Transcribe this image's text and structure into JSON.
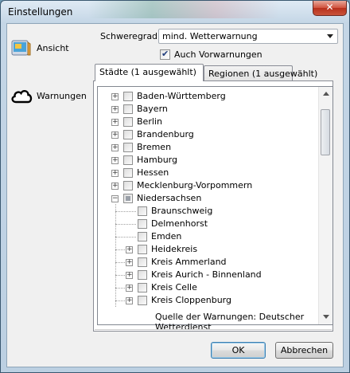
{
  "window": {
    "title": "Einstellungen",
    "close_glyph": "✕"
  },
  "sidebar": {
    "items": [
      {
        "label": "Ansicht",
        "icon": "display-icon"
      },
      {
        "label": "Warnungen",
        "icon": "cloud-icon"
      }
    ]
  },
  "settings": {
    "severity_label": "Schweregrad:",
    "severity_value": "mind. Wetterwarnung",
    "prewarnings_label": "Auch Vorwarnungen",
    "prewarnings_checked": true
  },
  "tabs": [
    {
      "label": "Städte (1 ausgewählt)",
      "active": true
    },
    {
      "label": "Regionen (1 ausgewählt)",
      "active": false
    }
  ],
  "tree": [
    {
      "label": "Baden-Württemberg",
      "level": 0,
      "expander": "+",
      "state": "unchecked"
    },
    {
      "label": "Bayern",
      "level": 0,
      "expander": "+",
      "state": "unchecked"
    },
    {
      "label": "Berlin",
      "level": 0,
      "expander": "+",
      "state": "unchecked"
    },
    {
      "label": "Brandenburg",
      "level": 0,
      "expander": "+",
      "state": "unchecked"
    },
    {
      "label": "Bremen",
      "level": 0,
      "expander": "+",
      "state": "unchecked"
    },
    {
      "label": "Hamburg",
      "level": 0,
      "expander": "+",
      "state": "unchecked"
    },
    {
      "label": "Hessen",
      "level": 0,
      "expander": "+",
      "state": "unchecked"
    },
    {
      "label": "Mecklenburg-Vorpommern",
      "level": 0,
      "expander": "+",
      "state": "unchecked"
    },
    {
      "label": "Niedersachsen",
      "level": 0,
      "expander": "−",
      "state": "partial"
    },
    {
      "label": "Braunschweig",
      "level": 1,
      "expander": "",
      "state": "unchecked"
    },
    {
      "label": "Delmenhorst",
      "level": 1,
      "expander": "",
      "state": "unchecked"
    },
    {
      "label": "Emden",
      "level": 1,
      "expander": "",
      "state": "unchecked"
    },
    {
      "label": "Heidekreis",
      "level": 1,
      "expander": "+",
      "state": "unchecked"
    },
    {
      "label": "Kreis Ammerland",
      "level": 1,
      "expander": "+",
      "state": "unchecked"
    },
    {
      "label": "Kreis Aurich - Binnenland",
      "level": 1,
      "expander": "+",
      "state": "unchecked"
    },
    {
      "label": "Kreis Celle",
      "level": 1,
      "expander": "+",
      "state": "unchecked"
    },
    {
      "label": "Kreis Cloppenburg",
      "level": 1,
      "expander": "+",
      "state": "unchecked"
    }
  ],
  "source_text": "Quelle der Warnungen: Deutscher Wetterdienst",
  "buttons": {
    "ok": "OK",
    "cancel": "Abbrechen"
  }
}
